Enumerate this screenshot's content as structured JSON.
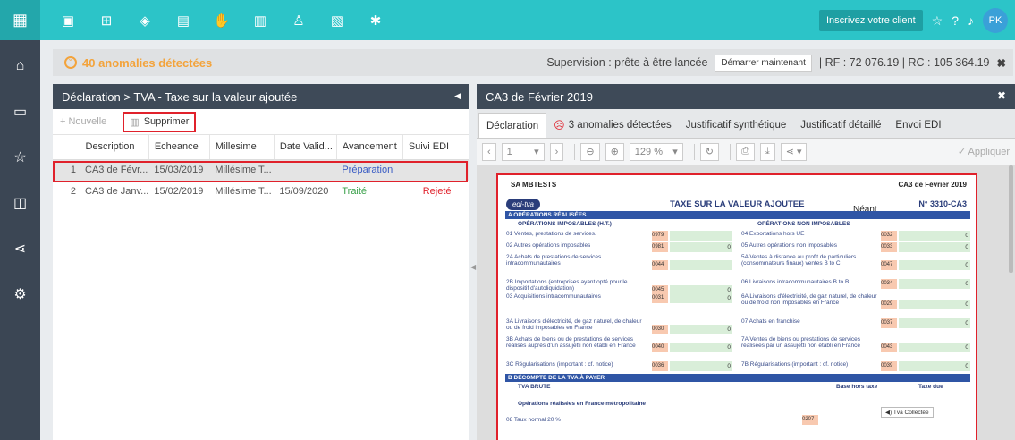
{
  "topbar": {
    "inscrire": "Inscrivez votre client",
    "avatar": "PK"
  },
  "alert": {
    "count_text": "40 anomalies détectées",
    "supervision": "Supervision : prête à être lancée",
    "demarrer": "Démarrer maintenant",
    "rf": "| RF : 72 076.19 | RC : 105 364.19"
  },
  "left": {
    "title": "Déclaration > TVA - Taxe sur la valeur ajoutée",
    "nouvelle": "+ Nouvelle",
    "supprimer": "Supprimer",
    "columns": [
      "Description",
      "Echeance",
      "Millesime",
      "Date Valid...",
      "Avancement",
      "Suivi EDI"
    ],
    "rows": [
      {
        "n": "1",
        "desc": "CA3 de Févr...",
        "ech": "15/03/2019",
        "mil": "Millésime T...",
        "dv": "",
        "av": "Préparation",
        "edi": ""
      },
      {
        "n": "2",
        "desc": "CA3 de Janv...",
        "ech": "15/02/2019",
        "mil": "Millésime T...",
        "dv": "15/09/2020",
        "av": "Traité",
        "edi": "Rejeté"
      }
    ]
  },
  "right": {
    "title": "CA3 de Février 2019",
    "tabs": [
      "Déclaration",
      "3 anomalies détectées",
      "Justificatif synthétique",
      "Justificatif détaillé",
      "Envoi EDI"
    ],
    "page": "1",
    "zoom": "129 %",
    "appliquer": "Appliquer"
  },
  "doc": {
    "company": "SA MBTESTS",
    "period": "CA3 de Février 2019",
    "logo": "edi-tva",
    "title": "TAXE SUR LA VALEUR AJOUTEE",
    "neant": "Néant",
    "num": "N° 3310-CA3",
    "secA": "A   OPÉRATIONS RÉALISÉES",
    "imp": "OPÉRATIONS IMPOSABLES (H.T.)",
    "nonimp": "OPÉRATIONS NON IMPOSABLES",
    "left_lines": [
      {
        "t": "01  Ventes, prestations de services.",
        "c": "0979",
        "v": ""
      },
      {
        "t": "02  Autres opérations imposables",
        "c": "0981",
        "v": "0"
      },
      {
        "t": "2A  Achats de prestations de services intracommunautaires",
        "c": "0044",
        "v": ""
      },
      {
        "t": "2B  Importations (entreprises ayant opté pour le dispositif d'autoliquidation)",
        "c": "0045",
        "v": "0"
      },
      {
        "t": "03  Acquisitions intracommunautaires",
        "c": "0031",
        "v": "0"
      },
      {
        "t": "3A  Livraisons d'électricité, de gaz naturel, de chaleur ou de froid imposables en France",
        "c": "0030",
        "v": "0"
      },
      {
        "t": "3B  Achats de biens ou de prestations de services réalisés auprès d'un assujetti non établi en France",
        "c": "0040",
        "v": "0"
      },
      {
        "t": "3C  Régularisations (important : cf. notice)",
        "c": "0036",
        "v": "0"
      }
    ],
    "right_lines": [
      {
        "t": "04  Exportations hors UE",
        "c": "0032",
        "v": "0"
      },
      {
        "t": "05  Autres opérations non imposables",
        "c": "0033",
        "v": "0"
      },
      {
        "t": "5A  Ventes à distance au profit de particuliers (consommateurs finaux) ventes B to C",
        "c": "0047",
        "v": "0"
      },
      {
        "t": "06  Livraisons intracommunautaires B to B",
        "c": "0034",
        "v": "0"
      },
      {
        "t": "6A  Livraisons d'électricité, de gaz naturel, de chaleur ou de froid non imposables en France",
        "c": "0029",
        "v": "0"
      },
      {
        "t": "07  Achats en franchise",
        "c": "0037",
        "v": "0"
      },
      {
        "t": "7A  Ventes de biens ou prestations de services réalisées par un assujetti non établi en France",
        "c": "0043",
        "v": "0"
      },
      {
        "t": "7B  Régularisations (important : cf. notice)",
        "c": "0039",
        "v": "0"
      }
    ],
    "secB": "B   DÉCOMPTE DE LA TVA À PAYER",
    "tvabrute": "TVA BRUTE",
    "base": "Base hors taxe",
    "taxe": "Taxe due",
    "opfr": "Opérations réalisées en France métropolitaine",
    "tvac": "Tva Collectée",
    "l08": "08  Taux normal 20 %",
    "c08": "0207"
  }
}
